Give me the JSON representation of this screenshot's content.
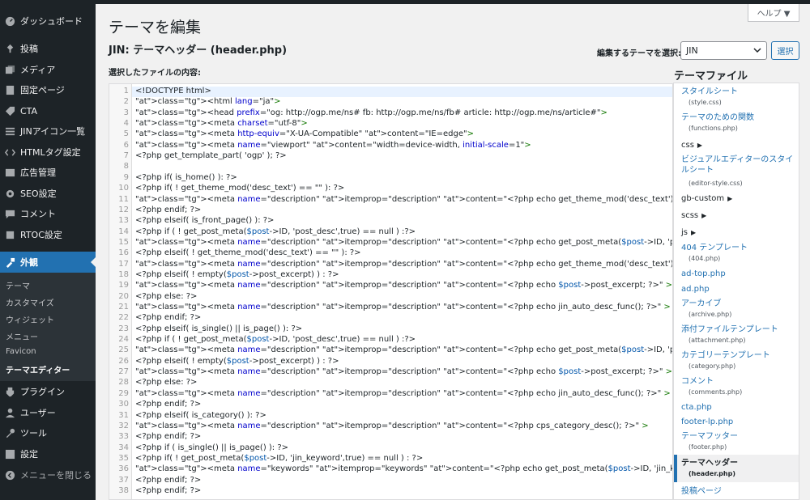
{
  "sidebar": {
    "items": [
      {
        "label": "ダッシュボード",
        "icon": "dashboard-icon"
      },
      {
        "label": "投稿",
        "icon": "pin-icon"
      },
      {
        "label": "メディア",
        "icon": "media-icon"
      },
      {
        "label": "固定ページ",
        "icon": "page-icon"
      },
      {
        "label": "CTA",
        "icon": "tag-icon"
      },
      {
        "label": "JINアイコン一覧",
        "icon": "list-icon"
      },
      {
        "label": "HTMLタグ設定",
        "icon": "code-icon"
      },
      {
        "label": "広告管理",
        "icon": "ad-icon"
      },
      {
        "label": "SEO設定",
        "icon": "gear-icon"
      },
      {
        "label": "コメント",
        "icon": "comment-icon"
      },
      {
        "label": "RTOC設定",
        "icon": "box-icon"
      },
      {
        "label": "外観",
        "icon": "brush-icon"
      },
      {
        "label": "プラグイン",
        "icon": "plugin-icon"
      },
      {
        "label": "ユーザー",
        "icon": "user-icon"
      },
      {
        "label": "ツール",
        "icon": "wrench-icon"
      },
      {
        "label": "設定",
        "icon": "settings-icon"
      },
      {
        "label": "メニューを閉じる",
        "icon": "collapse-icon"
      }
    ],
    "submenu": [
      "テーマ",
      "カスタマイズ",
      "ウィジェット",
      "メニュー",
      "Favicon",
      "テーマエディター"
    ]
  },
  "header": {
    "help": "ヘルプ ▼",
    "title": "テーマを編集",
    "file_title": "JIN: テーマヘッダー (header.php)",
    "select_label": "編集するテーマを選択:",
    "selected_theme": "JIN",
    "select_button": "選択",
    "content_label": "選択したファイルの内容:"
  },
  "files": {
    "heading": "テーマファイル",
    "items": [
      {
        "label": "スタイルシート",
        "sub": "(style.css)"
      },
      {
        "label": "テーマのための関数",
        "sub": "(functions.php)"
      },
      {
        "label": "css",
        "dir": true
      },
      {
        "label": "ビジュアルエディターのスタイルシート",
        "sub": "(editor-style.css)"
      },
      {
        "label": "gb-custom",
        "dir": true
      },
      {
        "label": "scss",
        "dir": true
      },
      {
        "label": "js",
        "dir": true
      },
      {
        "label": "404 テンプレート",
        "sub": "(404.php)"
      },
      {
        "label": "ad-top.php"
      },
      {
        "label": "ad.php"
      },
      {
        "label": "アーカイブ",
        "sub": "(archive.php)"
      },
      {
        "label": "添付ファイルテンプレート",
        "sub": "(attachment.php)"
      },
      {
        "label": "カテゴリーテンプレート",
        "sub": "(category.php)"
      },
      {
        "label": "コメント",
        "sub": "(comments.php)"
      },
      {
        "label": "cta.php"
      },
      {
        "label": "footer-lp.php"
      },
      {
        "label": "テーマフッター",
        "sub": "(footer.php)"
      },
      {
        "label": "テーマヘッダー",
        "sub": "(header.php)",
        "current": true
      },
      {
        "label": "投稿ページ"
      }
    ]
  },
  "code_lines": [
    "<!DOCTYPE html>",
    "<html lang=\"ja\">",
    "<head prefix=\"og: http://ogp.me/ns# fb: http://ogp.me/ns/fb# article: http://ogp.me/ns/article#\">",
    "<meta charset=\"utf-8\">",
    "<meta http-equiv=\"X-UA-Compatible\" content=\"IE=edge\">",
    "<meta name=\"viewport\" content=\"width=device-width, initial-scale=1\">",
    "<?php get_template_part( 'ogp' ); ?>",
    "",
    "<?php if( is_home() ): ?>",
    "<?php if( ! get_theme_mod('desc_text') == \"\" ): ?>",
    "<meta name=\"description\" itemprop=\"description\" content=\"<?php echo get_theme_mod('desc_text'); ?>\">",
    "<?php endif; ?>",
    "<?php elseif( is_front_page() ): ?>",
    "<?php if ( ! get_post_meta($post->ID, 'post_desc',true) == null ) :?>",
    "<meta name=\"description\" itemprop=\"description\" content=\"<?php echo get_post_meta($post->ID, 'post_desc',true) ?>\" >",
    "<?php elseif( ! get_theme_mod('desc_text') == \"\" ): ?>",
    "<meta name=\"description\" itemprop=\"description\" content=\"<?php echo get_theme_mod('desc_text'); ?>\">",
    "<?php elseif( ! empty($post->post_excerpt) ) : ?>",
    "<meta name=\"description\" itemprop=\"description\" content=\"<?php echo $post->post_excerpt; ?>\" >",
    "<?php else: ?>",
    "<meta name=\"description\" itemprop=\"description\" content=\"<?php echo jin_auto_desc_func(); ?>\" >",
    "<?php endif; ?>",
    "<?php elseif( is_single() || is_page() ): ?>",
    "<?php if ( ! get_post_meta($post->ID, 'post_desc',true) == null ) :?>",
    "<meta name=\"description\" itemprop=\"description\" content=\"<?php echo get_post_meta($post->ID, 'post_desc',true) ?>\" >",
    "<?php elseif( ! empty($post->post_excerpt) ) : ?>",
    "<meta name=\"description\" itemprop=\"description\" content=\"<?php echo $post->post_excerpt; ?>\" >",
    "<?php else: ?>",
    "<meta name=\"description\" itemprop=\"description\" content=\"<?php echo jin_auto_desc_func(); ?>\" >",
    "<?php endif; ?>",
    "<?php elseif( is_category() ): ?>",
    "<meta name=\"description\" itemprop=\"description\" content=\"<?php cps_category_desc(); ?>\" >",
    "<?php endif; ?>",
    "<?php if ( is_single() || is_page() ): ?>",
    "<?php if( ! get_post_meta($post->ID, 'jin_keyword',true) == null ) : ?>",
    "<meta name=\"keywords\" itemprop=\"keywords\" content=\"<?php echo get_post_meta($post->ID, 'jin_keyword',true) ?>\" >",
    "<?php endif; ?>",
    "<?php endif; ?>"
  ],
  "colors": {
    "sidebar_bg": "#1d2327",
    "accent": "#2271b1",
    "tag": "#117700",
    "attr": "#0000cc",
    "string": "#aa1111"
  }
}
